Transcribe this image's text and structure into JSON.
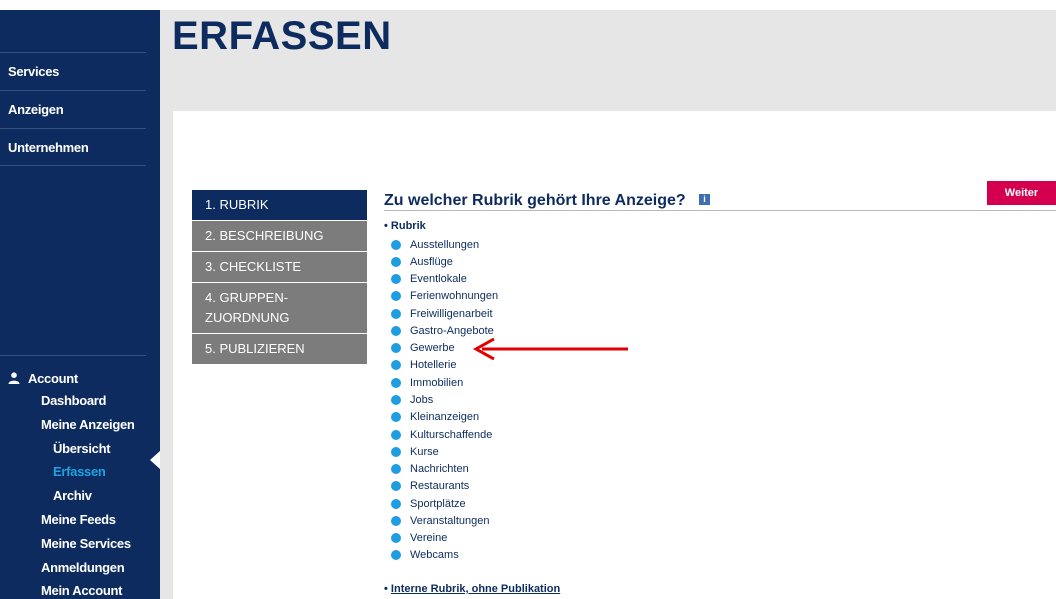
{
  "header": {
    "title": "ERFASSEN"
  },
  "sidebar": {
    "nav": [
      {
        "label": "Services"
      },
      {
        "label": "Anzeigen"
      },
      {
        "label": "Unternehmen"
      }
    ],
    "account": {
      "title": "Account",
      "links": [
        {
          "label": "Dashboard"
        },
        {
          "label": "Meine Anzeigen"
        },
        {
          "label": "Übersicht"
        },
        {
          "label": "Erfassen",
          "active": true
        },
        {
          "label": "Archiv"
        },
        {
          "label": "Meine Feeds"
        },
        {
          "label": "Meine Services"
        },
        {
          "label": "Anmeldungen"
        },
        {
          "label": "Mein Account"
        }
      ]
    }
  },
  "steps": [
    {
      "label": "1. RUBRIK",
      "active": true
    },
    {
      "label": "2. BESCHREIBUNG"
    },
    {
      "label": "3. CHECKLISTE"
    },
    {
      "label": "4. GRUPPEN-ZUORDNUNG"
    },
    {
      "label": "5. PUBLIZIEREN"
    }
  ],
  "main": {
    "question": "Zu welcher Rubrik gehört Ihre Anzeige?",
    "info_icon_glyph": "i",
    "next_button": "Weiter",
    "rubrik_label": "• Rubrik",
    "rubriken": [
      "Ausstellungen",
      "Ausflüge",
      "Eventlokale",
      "Ferienwohnungen",
      "Freiwilligenarbeit",
      "Gastro-Angebote",
      "Gewerbe",
      "Hotellerie",
      "Immobilien",
      "Jobs",
      "Kleinanzeigen",
      "Kulturschaffende",
      "Kurse",
      "Nachrichten",
      "Restaurants",
      "Sportplätze",
      "Veranstaltungen",
      "Vereine",
      "Webcams"
    ],
    "highlighted_rubrik": "Gewerbe",
    "internal_bullet": "• ",
    "internal_link": "Interne Rubrik, ohne Publikation"
  },
  "colors": {
    "navy": "#0d2b5e",
    "accent_blue": "#1e9ee0",
    "step_gray": "#7c7c7c",
    "button_magenta": "#d4004f",
    "annotation_red": "#e00000"
  }
}
